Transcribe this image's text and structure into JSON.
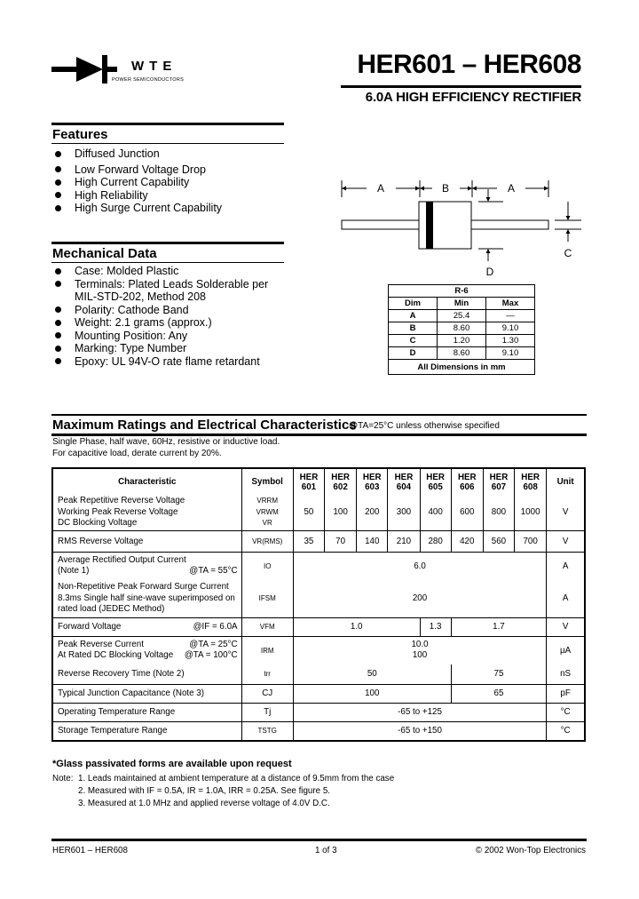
{
  "header": {
    "logo_brand": "WTE",
    "logo_tagline": "POWER SEMICONDUCTORS",
    "title": "HER601 – HER608",
    "subtitle": "6.0A HIGH EFFICIENCY RECTIFIER"
  },
  "features": {
    "title": "Features",
    "items": [
      "Diffused Junction",
      "Low Forward Voltage Drop",
      "High Current Capability",
      "High Reliability",
      "High Surge Current Capability"
    ]
  },
  "mechanical": {
    "title": "Mechanical Data",
    "items": [
      "Case: Molded Plastic",
      "Terminals: Plated Leads Solderable per MIL-STD-202, Method 208",
      "Polarity: Cathode Band",
      "Weight: 2.1 grams (approx.)",
      "Mounting Position: Any",
      "Marking: Type Number",
      "Epoxy: UL 94V-O rate flame retardant"
    ]
  },
  "diagram": {
    "labels": {
      "a_left": "A",
      "b": "B",
      "a_right": "A",
      "c": "C",
      "d": "D"
    }
  },
  "dimensions": {
    "package": "R-6",
    "headers": [
      "Dim",
      "Min",
      "Max"
    ],
    "rows": [
      [
        "A",
        "25.4",
        "—"
      ],
      [
        "B",
        "8.60",
        "9.10"
      ],
      [
        "C",
        "1.20",
        "1.30"
      ],
      [
        "D",
        "8.60",
        "9.10"
      ]
    ],
    "footer": "All Dimensions in mm"
  },
  "ratings": {
    "title": "Maximum Ratings and Electrical Characteristics",
    "condition": "@TA=25°C unless otherwise specified",
    "cond_line1": "Single Phase, half wave, 60Hz, resistive or inductive load.",
    "cond_line2": "For capacitive load, derate current by 20%.",
    "headers": {
      "characteristic": "Characteristic",
      "symbol": "Symbol",
      "parts_top": "HER",
      "parts": [
        "601",
        "602",
        "603",
        "604",
        "605",
        "606",
        "607",
        "608"
      ],
      "unit": "Unit"
    },
    "rows": {
      "vrrm": {
        "lines": [
          "Peak Repetitive Reverse Voltage",
          "Working Peak Reverse Voltage",
          "DC Blocking Voltage"
        ],
        "symbols": [
          "VRRM",
          "VRWM",
          "VR"
        ],
        "values": [
          "50",
          "100",
          "200",
          "300",
          "400",
          "600",
          "800",
          "1000"
        ],
        "unit": "V"
      },
      "vrms": {
        "label": "RMS Reverse Voltage",
        "symbol": "VR(RMS)",
        "values": [
          "35",
          "70",
          "140",
          "210",
          "280",
          "420",
          "560",
          "700"
        ],
        "unit": "V"
      },
      "io": {
        "line1": "Average Rectified Output Current",
        "line2": "(Note 1)",
        "cond": "@TA = 55°C",
        "symbol": "IO",
        "value": "6.0",
        "unit": "A"
      },
      "ifsm": {
        "lines": [
          "Non-Repetitive Peak Forward Surge Current",
          "8.3ms Single half sine-wave superimposed on",
          "rated load (JEDEC Method)"
        ],
        "symbol": "IFSM",
        "value": "200",
        "unit": "A"
      },
      "vfm": {
        "label": "Forward Voltage",
        "cond": "@IF = 6.0A",
        "symbol": "VFM",
        "values": [
          {
            "parts": "601-604",
            "value": "1.0"
          },
          {
            "parts": "605",
            "value": "1.3"
          },
          {
            "parts": "606-608",
            "value": "1.7"
          }
        ],
        "unit": "V"
      },
      "irm": {
        "line1": "Peak Reverse Current",
        "cond1": "@TA = 25°C",
        "line2": "At Rated DC Blocking Voltage",
        "cond2": "@TA = 100°C",
        "symbol": "IRM",
        "value1": "10.0",
        "value2": "100",
        "unit": "µA"
      },
      "trr": {
        "label": "Reverse Recovery Time (Note 2)",
        "symbol": "trr",
        "values": [
          {
            "parts": "601-605",
            "value": "50"
          },
          {
            "parts": "606-608",
            "value": "75"
          }
        ],
        "unit": "nS"
      },
      "cj": {
        "label": "Typical Junction Capacitance (Note 3)",
        "symbol": "CJ",
        "values": [
          {
            "parts": "601-605",
            "value": "100"
          },
          {
            "parts": "606-608",
            "value": "65"
          }
        ],
        "unit": "pF"
      },
      "tj": {
        "label": "Operating Temperature Range",
        "symbol": "Tj",
        "value": "-65 to +125",
        "unit": "°C"
      },
      "tstg": {
        "label": "Storage Temperature Range",
        "symbol": "TSTG",
        "value": "-65 to +150",
        "unit": "°C"
      }
    }
  },
  "notes": {
    "glass": "*Glass passivated forms are available upon request",
    "prefix": "Note:",
    "items": [
      "1. Leads maintained at ambient temperature at a distance of 9.5mm from the case",
      "2. Measured with IF = 0.5A, IR = 1.0A, IRR = 0.25A. See figure 5.",
      "3. Measured at 1.0 MHz and applied reverse voltage of 4.0V D.C."
    ]
  },
  "footer": {
    "left": "HER601 – HER608",
    "center": "1 of 3",
    "right": "© 2002 Won-Top Electronics"
  }
}
